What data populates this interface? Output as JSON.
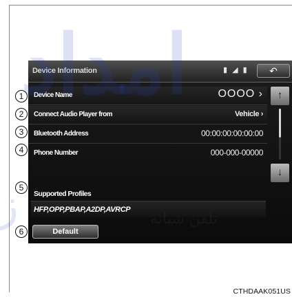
{
  "screen": {
    "title": "Device Information",
    "status_icons": [
      "▮",
      "◢",
      "▮"
    ],
    "back_label": "↶",
    "rows": [
      {
        "label": "Device Name",
        "value": "OOOO ›"
      },
      {
        "label": "Connect Audio Player from",
        "value": "Vehicle ›"
      },
      {
        "label": "Bluetooth Address",
        "value": "00:00:00:00:00:00"
      },
      {
        "label": "Phone Number",
        "value": "000-000-00000"
      }
    ],
    "supported_profiles_label": "Supported Profiles",
    "supported_profiles_value": "HFP,OPP,PBAP,A2DP,AVRCP",
    "default_button": "Default",
    "scroll_up": "↑",
    "scroll_down": "↓"
  },
  "callouts": [
    "1",
    "2",
    "3",
    "4",
    "5",
    "6"
  ],
  "watermark": {
    "main": "ﺍﻣﺪﺍﺩ",
    "sub": "ﺗﻠﻔﻦ ﺷﺒﺎﻧﻪ",
    "side": "ﺯ"
  },
  "caption": "CTHDAAK051US"
}
